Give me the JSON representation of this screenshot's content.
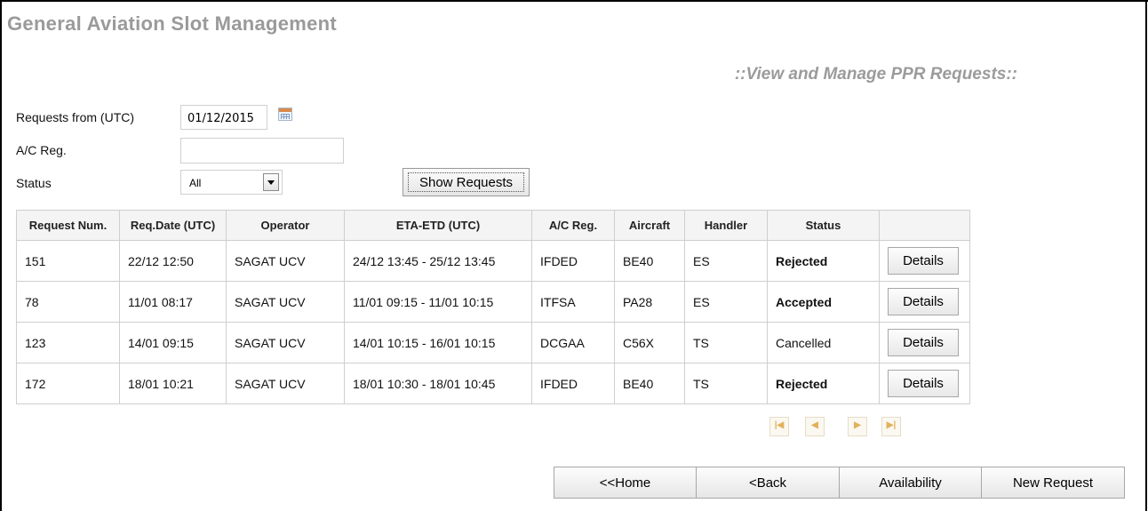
{
  "app_title": "General Aviation Slot Management",
  "page_subtitle": "::View and Manage PPR Requests::",
  "filters": {
    "requests_from_label": "Requests from (UTC)",
    "requests_from_value": "01/12/2015",
    "ac_reg_label": "A/C Reg.",
    "ac_reg_value": "",
    "status_label": "Status",
    "status_value": "All",
    "show_button": "Show Requests"
  },
  "table": {
    "headers": [
      "Request Num.",
      "Req.Date (UTC)",
      "Operator",
      "ETA-ETD (UTC)",
      "A/C Reg.",
      "Aircraft",
      "Handler",
      "Status",
      ""
    ],
    "rows": [
      {
        "num": "151",
        "date": "22/12 12:50",
        "operator": "SAGAT UCV",
        "eta_etd": "24/12 13:45 - 25/12 13:45",
        "reg": "IFDED",
        "aircraft": "BE40",
        "handler": "ES",
        "status": "Rejected",
        "details": "Details"
      },
      {
        "num": "78",
        "date": "11/01 08:17",
        "operator": "SAGAT UCV",
        "eta_etd": "11/01 09:15 - 11/01 10:15",
        "reg": "ITFSA",
        "aircraft": "PA28",
        "handler": "ES",
        "status": "Accepted",
        "details": "Details"
      },
      {
        "num": "123",
        "date": "14/01 09:15",
        "operator": "SAGAT UCV",
        "eta_etd": "14/01 10:15 - 16/01 10:15",
        "reg": "DCGAA",
        "aircraft": "C56X",
        "handler": "TS",
        "status": "Cancelled",
        "details": "Details"
      },
      {
        "num": "172",
        "date": "18/01 10:21",
        "operator": "SAGAT UCV",
        "eta_etd": "18/01 10:30 - 18/01 10:45",
        "reg": "IFDED",
        "aircraft": "BE40",
        "handler": "TS",
        "status": "Rejected",
        "details": "Details"
      }
    ]
  },
  "status_colors": {
    "Rejected": "#cc0000",
    "Accepted": "#2ea02e",
    "Cancelled": "#aaaaaa"
  },
  "pager_icons": [
    "first-page-icon",
    "prev-page-icon",
    "next-page-icon",
    "last-page-icon"
  ],
  "nav": {
    "home": "<<Home",
    "back": "<Back",
    "availability": "Availability",
    "new_request": "New Request"
  }
}
